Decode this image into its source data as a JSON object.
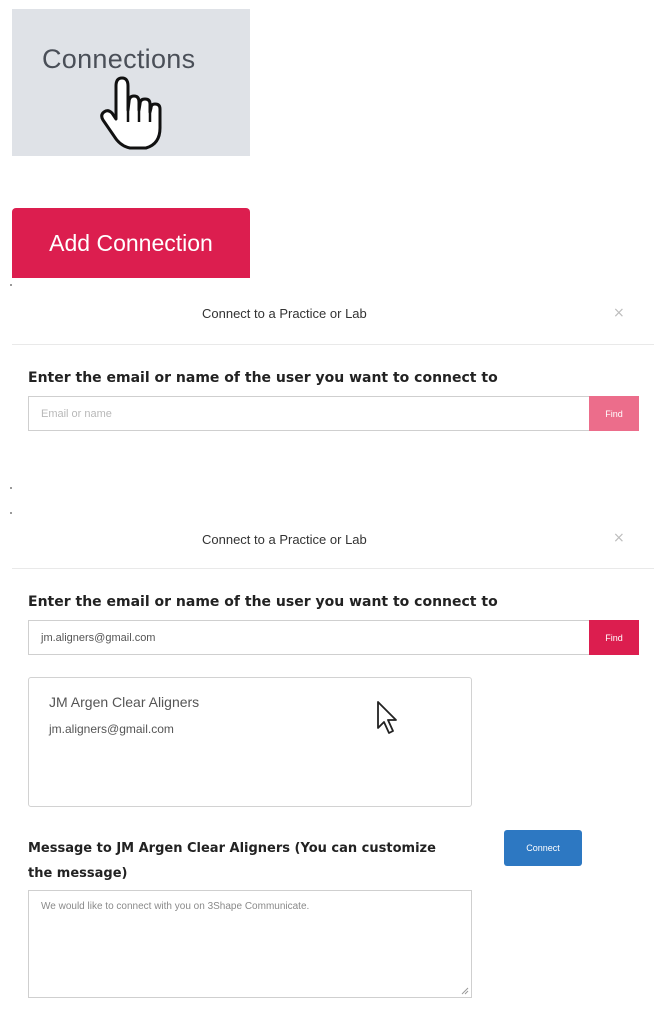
{
  "connections_tile": {
    "label": "Connections"
  },
  "add_connection": {
    "label": "Add Connection"
  },
  "dialog1": {
    "title": "Connect to a Practice or Lab",
    "close": "×",
    "prompt": "Enter the email or name of the user you want to connect to",
    "search_placeholder": "Email or name",
    "find_label": "Find"
  },
  "dialog2": {
    "title": "Connect to a Practice or Lab",
    "close": "×",
    "prompt": "Enter the email or name of the user you want to connect to",
    "search_value": "jm.aligners@gmail.com",
    "find_label": "Find",
    "result": {
      "name": "JM Argen Clear Aligners",
      "email": "jm.aligners@gmail.com"
    },
    "message_label": "Message to JM Argen Clear Aligners (You can customize the message)",
    "connect_label": "Connect",
    "message_text": "We would like to connect with you on 3Shape Communicate."
  },
  "colors": {
    "accent": "#dc1e4f",
    "find_disabled": "#ec6d8b",
    "connect_blue": "#2d78c2",
    "tile_bg": "#dfe2e7"
  },
  "icons": [
    "hand-pointer-icon",
    "arrow-cursor-icon",
    "close-icon",
    "resize-grip-icon"
  ]
}
